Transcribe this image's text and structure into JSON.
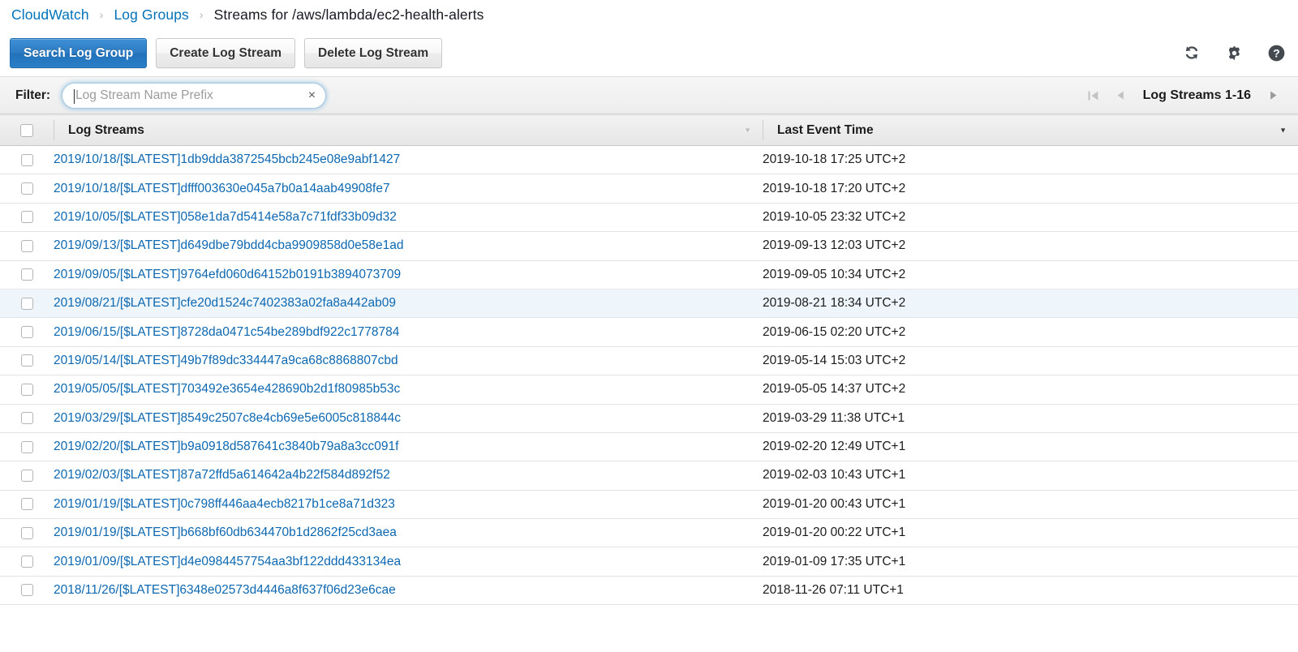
{
  "breadcrumb": {
    "root": "CloudWatch",
    "section": "Log Groups",
    "current": "Streams for /aws/lambda/ec2-health-alerts",
    "separator": "›"
  },
  "toolbar": {
    "search_label": "Search Log Group",
    "create_label": "Create Log Stream",
    "delete_label": "Delete Log Stream",
    "icons": {
      "refresh": "refresh-icon",
      "settings": "gear-icon",
      "help": "help-icon"
    }
  },
  "filter": {
    "label": "Filter:",
    "placeholder": "Log Stream Name Prefix",
    "value": "",
    "clear_glyph": "×"
  },
  "pagination": {
    "first_glyph": "❘◀",
    "prev_glyph": "◀",
    "next_glyph": "▶",
    "label": "Log Streams 1-16",
    "first_enabled": false,
    "prev_enabled": false,
    "next_enabled": true
  },
  "table": {
    "columns": {
      "name": "Log Streams",
      "time": "Last Event Time"
    },
    "sort_caret": "▼",
    "rows": [
      {
        "name": "2019/10/18/[$LATEST]1db9dda3872545bcb245e08e9abf1427",
        "time": "2019-10-18 17:25 UTC+2",
        "highlighted": false
      },
      {
        "name": "2019/10/18/[$LATEST]dfff003630e045a7b0a14aab49908fe7",
        "time": "2019-10-18 17:20 UTC+2",
        "highlighted": false
      },
      {
        "name": "2019/10/05/[$LATEST]058e1da7d5414e58a7c71fdf33b09d32",
        "time": "2019-10-05 23:32 UTC+2",
        "highlighted": false
      },
      {
        "name": "2019/09/13/[$LATEST]d649dbe79bdd4cba9909858d0e58e1ad",
        "time": "2019-09-13 12:03 UTC+2",
        "highlighted": false
      },
      {
        "name": "2019/09/05/[$LATEST]9764efd060d64152b0191b3894073709",
        "time": "2019-09-05 10:34 UTC+2",
        "highlighted": false
      },
      {
        "name": "2019/08/21/[$LATEST]cfe20d1524c7402383a02fa8a442ab09",
        "time": "2019-08-21 18:34 UTC+2",
        "highlighted": true
      },
      {
        "name": "2019/06/15/[$LATEST]8728da0471c54be289bdf922c1778784",
        "time": "2019-06-15 02:20 UTC+2",
        "highlighted": false
      },
      {
        "name": "2019/05/14/[$LATEST]49b7f89dc334447a9ca68c8868807cbd",
        "time": "2019-05-14 15:03 UTC+2",
        "highlighted": false
      },
      {
        "name": "2019/05/05/[$LATEST]703492e3654e428690b2d1f80985b53c",
        "time": "2019-05-05 14:37 UTC+2",
        "highlighted": false
      },
      {
        "name": "2019/03/29/[$LATEST]8549c2507c8e4cb69e5e6005c818844c",
        "time": "2019-03-29 11:38 UTC+1",
        "highlighted": false
      },
      {
        "name": "2019/02/20/[$LATEST]b9a0918d587641c3840b79a8a3cc091f",
        "time": "2019-02-20 12:49 UTC+1",
        "highlighted": false
      },
      {
        "name": "2019/02/03/[$LATEST]87a72ffd5a614642a4b22f584d892f52",
        "time": "2019-02-03 10:43 UTC+1",
        "highlighted": false
      },
      {
        "name": "2019/01/19/[$LATEST]0c798ff446aa4ecb8217b1ce8a71d323",
        "time": "2019-01-20 00:43 UTC+1",
        "highlighted": false
      },
      {
        "name": "2019/01/19/[$LATEST]b668bf60db634470b1d2862f25cd3aea",
        "time": "2019-01-20 00:22 UTC+1",
        "highlighted": false
      },
      {
        "name": "2019/01/09/[$LATEST]d4e0984457754aa3bf122ddd433134ea",
        "time": "2019-01-09 17:35 UTC+1",
        "highlighted": false
      },
      {
        "name": "2018/11/26/[$LATEST]6348e02573d4446a8f637f06d23e6cae",
        "time": "2018-11-26 07:11 UTC+1",
        "highlighted": false
      }
    ]
  },
  "colors": {
    "link": "#0073bb",
    "stream_link": "#0d68b1",
    "primary_button": "#2272bb",
    "row_highlight": "#eef6fb"
  }
}
